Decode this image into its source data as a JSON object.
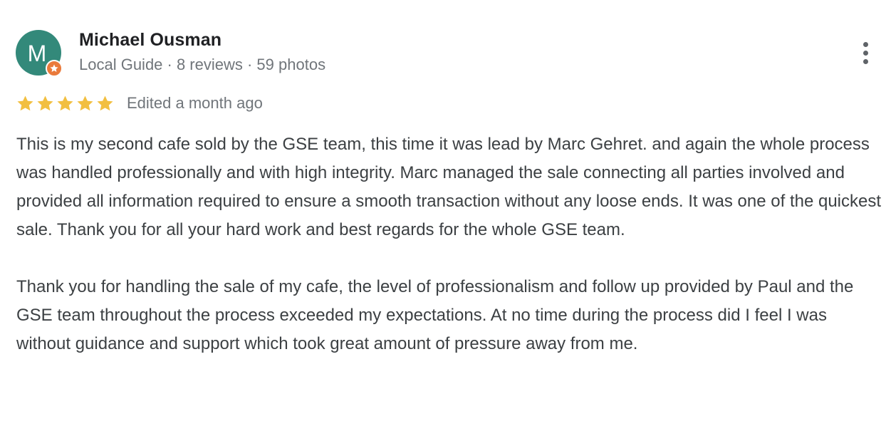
{
  "author": {
    "avatar_letter": "M",
    "avatar_color": "#33897a",
    "badge_color": "#ea7a3b",
    "name": "Michael Ousman",
    "meta": "Local Guide · 8 reviews · 59 photos"
  },
  "rating": {
    "stars": 5,
    "star_color": "#f2bf40",
    "edited": "Edited a month ago"
  },
  "review": {
    "paragraphs": [
      "This is my second cafe sold by the GSE team, this time it was lead by Marc Gehret. and again the whole process was handled professionally and with high integrity. Marc managed the sale connecting all parties involved and provided all information required to ensure a smooth transaction without any loose ends. It was one of the quickest sale. Thank you for all your hard work and best regards for the whole GSE team.",
      "Thank you for handling the sale of my cafe, the level of professionalism and follow up provided by Paul and the GSE team throughout the process exceeded my expectations. At no time during the process did I feel I was without guidance and support which took great amount of pressure away from me."
    ]
  },
  "icons": {
    "more": "more-vert-icon",
    "star": "star-icon",
    "badge": "local-guide-star-icon"
  }
}
